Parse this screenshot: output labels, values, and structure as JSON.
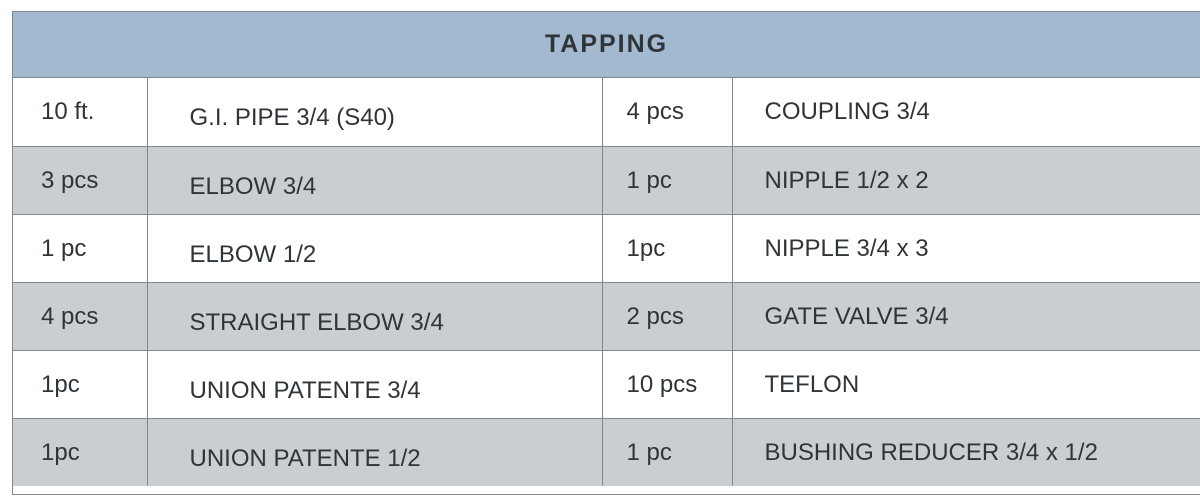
{
  "title": "TAPPING",
  "rows": [
    {
      "qty1": "10 ft.",
      "item1": "G.I. PIPE 3/4 (S40)",
      "qty2": "4 pcs",
      "item2": "COUPLING 3/4"
    },
    {
      "qty1": "3 pcs",
      "item1": "ELBOW 3/4",
      "qty2": "1 pc",
      "item2": "NIPPLE 1/2 x 2"
    },
    {
      "qty1": "1 pc",
      "item1": "ELBOW 1/2",
      "qty2": "1pc",
      "item2": "NIPPLE 3/4 x 3"
    },
    {
      "qty1": "4 pcs",
      "item1": "STRAIGHT ELBOW 3/4",
      "qty2": "2 pcs",
      "item2": "GATE VALVE 3/4"
    },
    {
      "qty1": "1pc",
      "item1": "UNION PATENTE 3/4",
      "qty2": "10 pcs",
      "item2": "TEFLON"
    },
    {
      "qty1": "1pc",
      "item1": "UNION PATENTE 1/2",
      "qty2": "1 pc",
      "item2": "BUSHING REDUCER 3/4 x 1/2"
    }
  ],
  "colors": {
    "header_bg": "#a3b9cf",
    "stripe_bg": "#c9ced3",
    "border": "#7f8790",
    "text": "#2f3439"
  }
}
